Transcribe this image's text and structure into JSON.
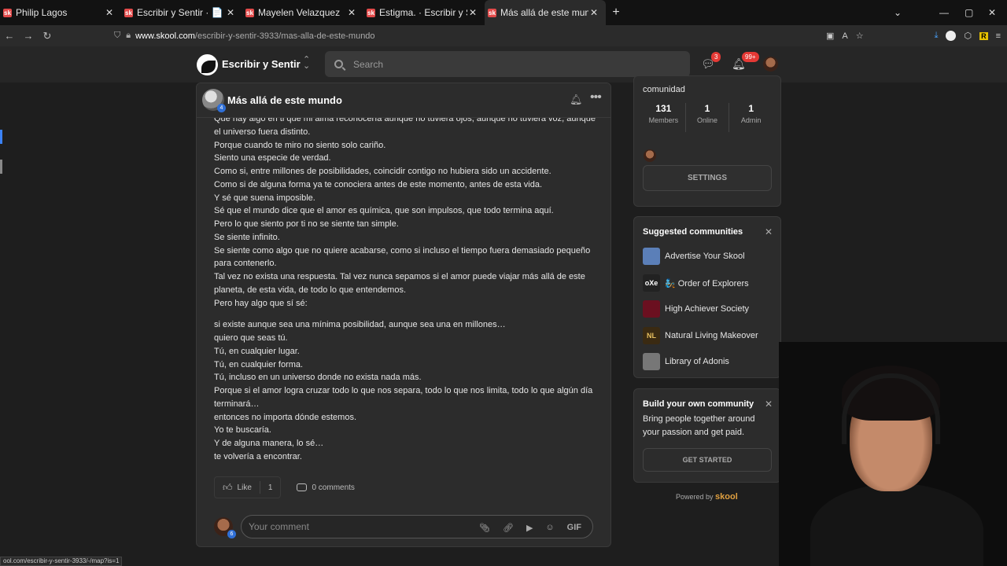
{
  "browser": {
    "tabs": [
      {
        "title": "Philip Lagos",
        "favicon": "sk"
      },
      {
        "title": "Escribir y Sentir · 📄 | Textos pr",
        "favicon": "sk"
      },
      {
        "title": "Mayelen Velazquez",
        "favicon": "sk"
      },
      {
        "title": "Estigma. · Escribir y Sentir",
        "favicon": "sk"
      },
      {
        "title": "Más allá de este mundo · Escrib",
        "favicon": "sk"
      }
    ],
    "url_domain": "www.skool.com",
    "url_path": "/escribir-y-sentir-3933/mas-alla-de-este-mundo",
    "status_url": "ool.com/escribir-y-sentir-3933/-/map?is=1"
  },
  "header": {
    "community_name": "Escribir y Sentir",
    "search_placeholder": "Search",
    "chat_badge": "3",
    "notif_badge": "99+"
  },
  "post": {
    "title": "Más allá de este mundo",
    "author_level": "4",
    "lines_a": [
      "Que hay algo en ti que mi alma reconocería aunque no tuviera ojos, aunque no tuviera voz, aunque el universo fuera distinto.",
      "Porque cuando te miro no siento solo cariño.",
      "Siento una especie de verdad.",
      "Como si, entre millones de posibilidades, coincidir contigo no hubiera sido un accidente.",
      "Como si de alguna forma ya te conociera antes de este momento, antes de esta vida.",
      "Y sé que suena imposible.",
      "Sé que el mundo dice que el amor es química, que son impulsos, que todo termina aquí.",
      "Pero lo que siento por ti no se siente tan simple.",
      "Se siente infinito.",
      "Se siente como algo que no quiere acabarse, como si incluso el tiempo fuera demasiado pequeño para contenerlo.",
      "Tal vez no exista una respuesta. Tal vez nunca sepamos si el amor puede viajar más allá de este planeta, de esta vida, de todo lo que entendemos.",
      "Pero hay algo que sí sé:"
    ],
    "lines_b": [
      "si existe aunque sea una mínima posibilidad, aunque sea una en millones…",
      "quiero que seas tú.",
      "Tú, en cualquier lugar.",
      "Tú, en cualquier forma.",
      "Tú, incluso en un universo donde no exista nada más.",
      "Porque si el amor logra cruzar todo lo que nos separa, todo lo que nos limita, todo lo que algún día terminará…",
      "entonces no importa dónde estemos.",
      "Yo te buscaría.",
      "Y de alguna manera, lo sé…",
      "te volvería a encontrar."
    ],
    "like_label": "Like",
    "like_count": "1",
    "comments_label": "0 comments",
    "comment_placeholder": "Your comment",
    "commenter_level": "6",
    "gif_label": "GIF"
  },
  "sidebar": {
    "community_label": "comunidad",
    "stats": [
      {
        "value": "131",
        "label": "Members"
      },
      {
        "value": "1",
        "label": "Online"
      },
      {
        "value": "1",
        "label": "Admin"
      }
    ],
    "settings_label": "SETTINGS",
    "suggested_title": "Suggested communities",
    "suggested": [
      {
        "name": "Advertise Your Skool",
        "thumb": "",
        "color": "#5b7fb8"
      },
      {
        "name": "🧞 Order of Explorers",
        "thumb": "oXe",
        "color": "#222222"
      },
      {
        "name": "High Achiever Society",
        "thumb": "",
        "color": "#6b1020"
      },
      {
        "name": "Natural Living Makeover",
        "thumb": "NL",
        "color": "#3a2a12"
      },
      {
        "name": "Library of Adonis",
        "thumb": "",
        "color": "#777777"
      }
    ],
    "build_title": "Build your own community",
    "build_text": "Bring people together around your passion and get paid.",
    "get_started_label": "GET STARTED",
    "powered_by": "Powered by",
    "powered_brand": "skool"
  }
}
